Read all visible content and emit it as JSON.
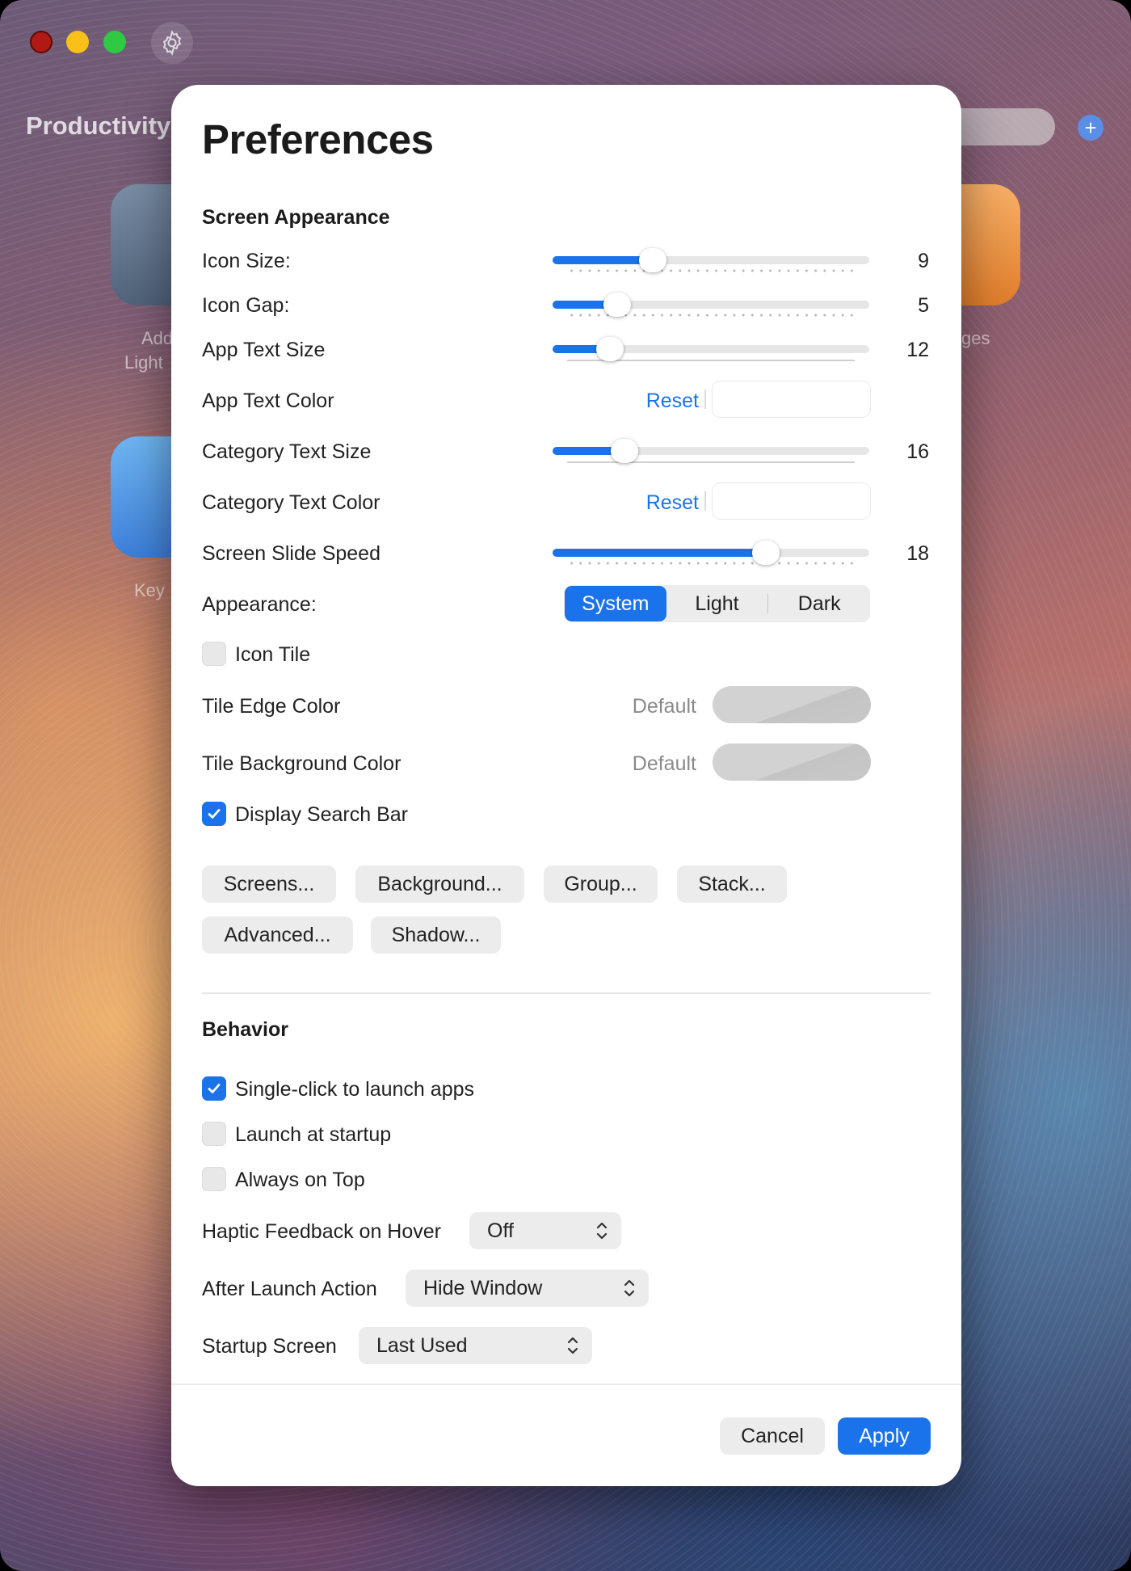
{
  "background": {
    "category_title": "Productivity",
    "app_labels": [
      "Add",
      "Light",
      "Key",
      "ges"
    ]
  },
  "title": "Preferences",
  "screen_appearance": {
    "heading": "Screen Appearance",
    "icon_size": {
      "label": "Icon Size:",
      "value": "9",
      "fraction": 0.3
    },
    "icon_gap": {
      "label": "Icon Gap:",
      "value": "5",
      "fraction": 0.175
    },
    "app_text_size": {
      "label": "App Text Size",
      "value": "12",
      "fraction": 0.15
    },
    "app_text_color": {
      "label": "App Text Color",
      "reset": "Reset"
    },
    "category_text_size": {
      "label": "Category Text Size",
      "value": "16",
      "fraction": 0.2
    },
    "category_text_color": {
      "label": "Category Text Color",
      "reset": "Reset"
    },
    "screen_slide_speed": {
      "label": "Screen Slide Speed",
      "value": "18",
      "fraction": 0.69
    },
    "appearance": {
      "label": "Appearance:",
      "options": [
        "System",
        "Light",
        "Dark"
      ],
      "selected": "System"
    },
    "icon_tile": {
      "label": "Icon Tile",
      "checked": false
    },
    "tile_edge_color": {
      "label": "Tile Edge Color",
      "default": "Default"
    },
    "tile_background_color": {
      "label": "Tile Background Color",
      "default": "Default"
    },
    "display_search_bar": {
      "label": "Display Search Bar",
      "checked": true
    },
    "buttons": [
      "Screens...",
      "Background...",
      "Group...",
      "Stack...",
      "Advanced...",
      "Shadow..."
    ]
  },
  "behavior": {
    "heading": "Behavior",
    "single_click": {
      "label": "Single-click to launch apps",
      "checked": true
    },
    "launch_at_startup": {
      "label": "Launch at startup",
      "checked": false
    },
    "always_on_top": {
      "label": "Always on Top",
      "checked": false
    },
    "haptic": {
      "label": "Haptic Feedback on Hover",
      "value": "Off"
    },
    "after_launch": {
      "label": "After Launch Action",
      "value": "Hide Window"
    },
    "startup_screen": {
      "label": "Startup Screen",
      "value": "Last Used"
    }
  },
  "footer": {
    "cancel": "Cancel",
    "apply": "Apply"
  },
  "colors": {
    "accent": "#1a73ea",
    "close": "#b11a14",
    "minimize": "#f7c11a",
    "maximize": "#2fc943"
  }
}
